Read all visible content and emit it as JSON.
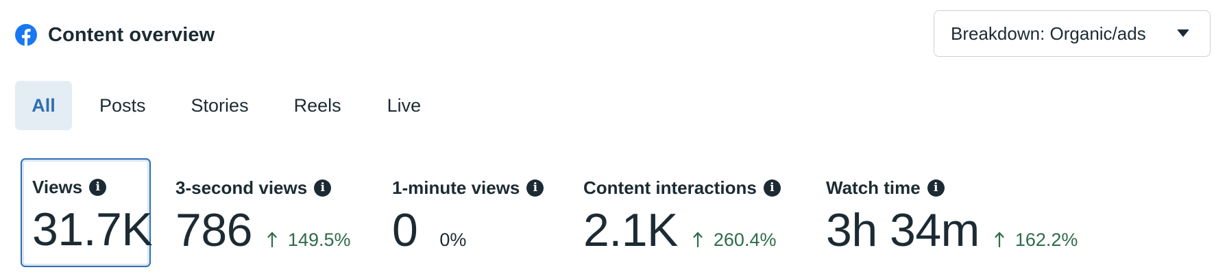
{
  "header": {
    "title": "Content overview",
    "icon": "facebook-icon",
    "brand_color": "#1877f2"
  },
  "breakdown": {
    "label": "Breakdown: Organic/ads",
    "icon": "caret-down-icon"
  },
  "tabs": [
    {
      "label": "All",
      "active": true
    },
    {
      "label": "Posts",
      "active": false
    },
    {
      "label": "Stories",
      "active": false
    },
    {
      "label": "Reels",
      "active": false
    },
    {
      "label": "Live",
      "active": false
    }
  ],
  "metrics": [
    {
      "label": "Views",
      "value": "31.7K",
      "change": "",
      "selected": true
    },
    {
      "label": "3-second views",
      "value": "786",
      "change": "149.5%",
      "trend": "up"
    },
    {
      "label": "1-minute views",
      "value": "0",
      "change": "0%",
      "trend": "none"
    },
    {
      "label": "Content interactions",
      "value": "2.1K",
      "change": "260.4%",
      "trend": "up"
    },
    {
      "label": "Watch time",
      "value": "3h 34m",
      "change": "162.2%",
      "trend": "up"
    }
  ],
  "colors": {
    "accent": "#2f6fb3",
    "tab_active_bg": "#e4edf4",
    "positive": "#2e6b4a",
    "text": "#1c2b33"
  }
}
